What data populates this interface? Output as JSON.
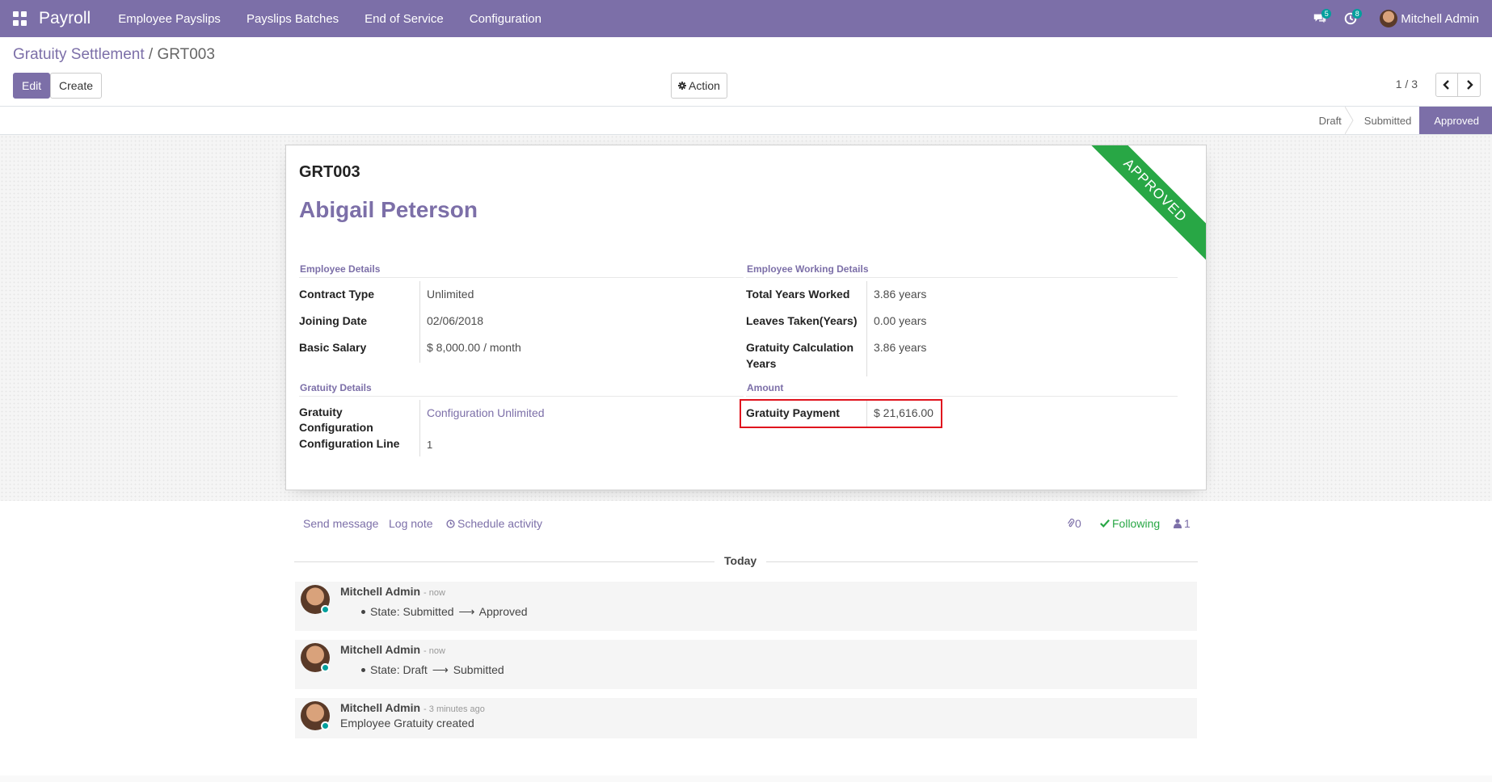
{
  "navbar": {
    "app_name": "Payroll",
    "menu": [
      "Employee Payslips",
      "Payslips Batches",
      "End of Service",
      "Configuration"
    ],
    "messages_count": "5",
    "activities_count": "8",
    "user_name": "Mitchell Admin"
  },
  "breadcrumb": {
    "parent": "Gratuity Settlement",
    "separator": " / ",
    "current": "GRT003"
  },
  "buttons": {
    "edit": "Edit",
    "create": "Create",
    "action": "Action"
  },
  "pager": {
    "value": "1 / 3"
  },
  "stages": {
    "items": [
      "Draft",
      "Submitted",
      "Approved"
    ],
    "active": "Approved"
  },
  "record": {
    "ribbon": "APPROVED",
    "reference": "GRT003",
    "employee": "Abigail Peterson",
    "employee_details": {
      "title": "Employee Details",
      "contract_type_label": "Contract Type",
      "contract_type": "Unlimited",
      "joining_date_label": "Joining Date",
      "joining_date": "02/06/2018",
      "basic_salary_label": "Basic Salary",
      "basic_salary": "$ 8,000.00",
      "basic_salary_unit": "/ month"
    },
    "working_details": {
      "title": "Employee Working Details",
      "total_years_label": "Total Years Worked",
      "total_years": "3.86 years",
      "leaves_label": "Leaves Taken(Years)",
      "leaves": "0.00 years",
      "calc_years_label": "Gratuity Calculation Years",
      "calc_years": "3.86 years"
    },
    "gratuity_details": {
      "title": "Gratuity Details",
      "config_label": "Gratuity Configuration",
      "config": "Configuration Unlimited",
      "line_label": "Configuration Line",
      "line": "1"
    },
    "amount": {
      "title": "Amount",
      "payment_label": "Gratuity Payment",
      "payment": "$ 21,616.00"
    }
  },
  "chatter": {
    "send_message": "Send message",
    "log_note": "Log note",
    "schedule_activity": "Schedule activity",
    "attachments": "0",
    "following": "Following",
    "followers": "1",
    "today": "Today",
    "messages": [
      {
        "author": "Mitchell Admin",
        "time": "- now",
        "field": "State:",
        "from": "Submitted",
        "to": "Approved"
      },
      {
        "author": "Mitchell Admin",
        "time": "- now",
        "field": "State:",
        "from": "Draft",
        "to": "Submitted"
      },
      {
        "author": "Mitchell Admin",
        "time": "- 3 minutes ago",
        "text": "Employee Gratuity created"
      }
    ]
  },
  "colors": {
    "brand": "#7c6fa8",
    "ribbon": "#28a745",
    "highlight": "#e0141e",
    "badge": "#00a09d"
  }
}
